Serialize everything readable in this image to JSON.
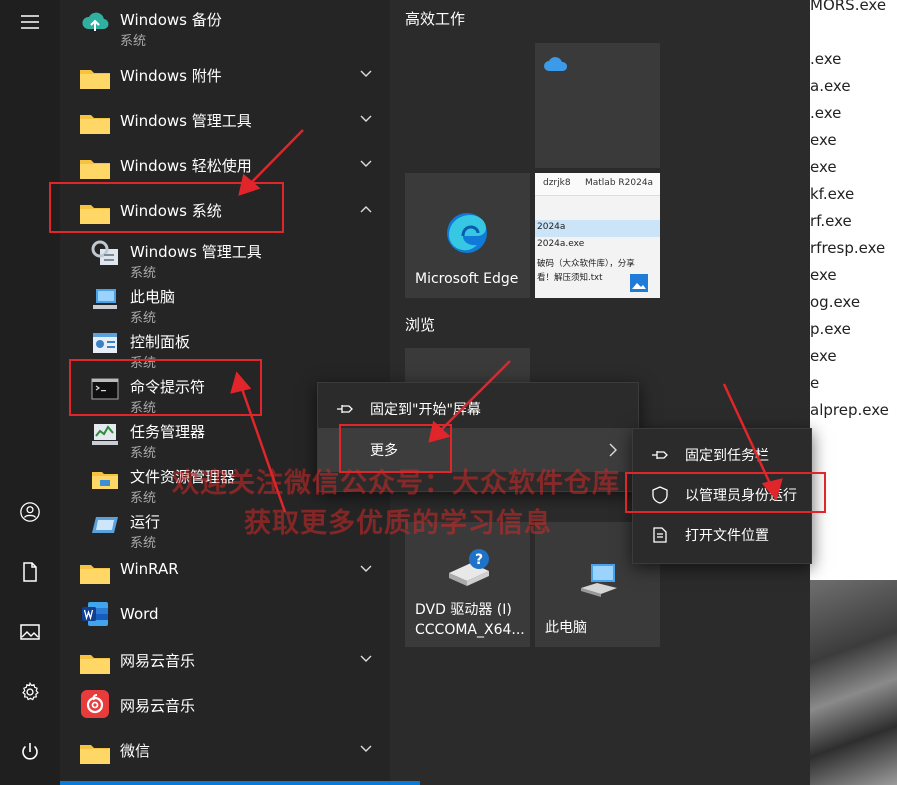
{
  "app_list": {
    "top_item": {
      "name": "Windows 备份",
      "sub": "系统"
    },
    "folders": [
      {
        "name": "Windows 附件"
      },
      {
        "name": "Windows 管理工具"
      },
      {
        "name": "Windows 轻松使用"
      },
      {
        "name": "Windows 系统"
      }
    ],
    "system_children": [
      {
        "name": "Windows 管理工具",
        "sub": "系统"
      },
      {
        "name": "此电脑",
        "sub": "系统"
      },
      {
        "name": "控制面板",
        "sub": "系统"
      },
      {
        "name": "命令提示符",
        "sub": "系统"
      },
      {
        "name": "任务管理器",
        "sub": "系统"
      },
      {
        "name": "文件资源管理器",
        "sub": "系统"
      },
      {
        "name": "运行",
        "sub": "系统"
      }
    ],
    "bottom_items": [
      {
        "name": "WinRAR"
      },
      {
        "name": "Word"
      },
      {
        "name": "网易云音乐"
      },
      {
        "name": "网易云音乐"
      },
      {
        "name": "微信"
      }
    ]
  },
  "tiles": {
    "group1_title": "高效工作",
    "group2_title": "浏览",
    "edge_label": "Microsoft Edge",
    "dvd_label_line1": "DVD 驱动器 (I)",
    "dvd_label_line2": "CCCOMA_X64...",
    "pc_label": "此电脑",
    "preview": {
      "crumb1": "dzrjk8",
      "crumb2": "Matlab R2024a",
      "line1": "2024a",
      "line2": "2024a.exe",
      "line3": "破码（大众软件库），分享",
      "line4": "看！解压须知.txt"
    }
  },
  "context_menu": {
    "pin_start": "固定到\"开始\"屏幕",
    "more": "更多"
  },
  "submenu": {
    "pin_taskbar": "固定到任务栏",
    "run_as_admin": "以管理员身份运行",
    "open_location": "打开文件位置"
  },
  "files": [
    "MORS.exe",
    ".exe",
    "a.exe",
    ".exe",
    "exe",
    "exe",
    "kf.exe",
    "rf.exe",
    "rfresp.exe",
    "exe",
    "og.exe",
    "p.exe",
    "exe",
    "e",
    "alprep.exe"
  ],
  "watermark": {
    "line1": "欢迎关注微信公众号：大众软件仓库",
    "line2": "获取更多优质的学习信息"
  },
  "colors": {
    "accent": "#0a7ad7",
    "annotation": "#e0252b"
  }
}
